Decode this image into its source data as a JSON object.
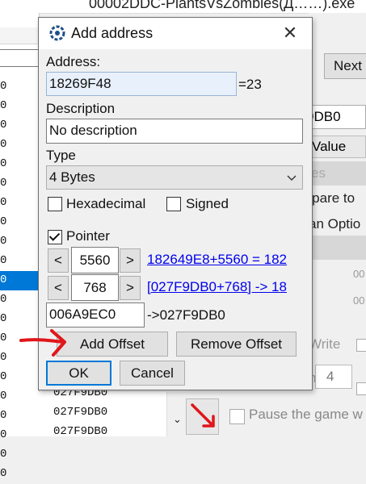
{
  "background": {
    "window_title_fragment": "00002DDC-PlantsVsZombies(Д……).exe",
    "left_column_rows": [
      "0",
      "0",
      "0",
      "0",
      "0",
      "0",
      "0",
      "0",
      "0",
      "0",
      "0",
      "0",
      "0",
      "0",
      "0",
      "0",
      "0",
      "0",
      "0",
      "0",
      "0"
    ],
    "selected_row_index": 10,
    "address_list_items": [
      "027F9DB0",
      "027F9DB0",
      "027F9DB0"
    ],
    "next_button": "Next",
    "value_field": "9DB0",
    "value_header": "Value",
    "gray_text": "es",
    "compare_to": "mpare to",
    "scan_options": "an Optio",
    "dim_values": [
      "00",
      "00"
    ],
    "write_label": "Write",
    "spin_prefix": "n",
    "spin_value": "4",
    "pause_label": "Pause the game w"
  },
  "dialog": {
    "title": "Add address",
    "address_label": "Address:",
    "address_value": "18269F48",
    "address_result": "=23",
    "description_label": "Description",
    "description_value": "No description",
    "type_label": "Type",
    "type_value": "4 Bytes",
    "hex_label": "Hexadecimal",
    "hex_checked": false,
    "signed_label": "Signed",
    "signed_checked": false,
    "pointer_label": "Pointer",
    "pointer_checked": true,
    "offsets": [
      {
        "dec": "<",
        "inc": ">",
        "value": "5560",
        "link": "182649E8+5560 = 182"
      },
      {
        "dec": "<",
        "inc": ">",
        "value": "768",
        "link": "[027F9DB0+768] -> 18"
      }
    ],
    "base_address": "006A9EC0",
    "base_result": "->027F9DB0",
    "add_offset": "Add Offset",
    "remove_offset": "Remove Offset",
    "ok": "OK",
    "cancel": "Cancel"
  },
  "colors": {
    "selection": "#0078d7",
    "link": "#0000ee",
    "annotation_arrow": "#e0161a"
  }
}
